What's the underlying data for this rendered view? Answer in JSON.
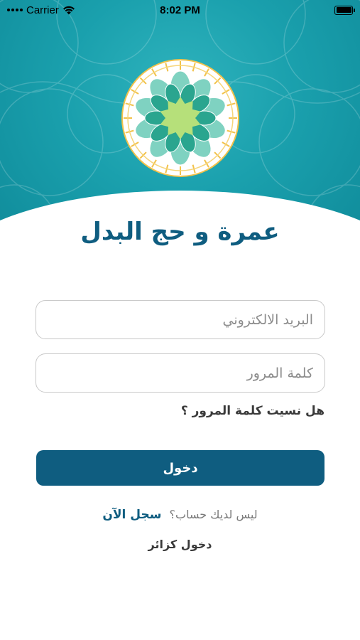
{
  "status_bar": {
    "carrier": "Carrier",
    "time": "8:02 PM",
    "icons": [
      "signal-dots-icon",
      "wifi-icon",
      "battery-icon"
    ]
  },
  "app": {
    "title": "عمرة و حج البدل",
    "logo_icon": "islamic-rosette-logo"
  },
  "form": {
    "email_placeholder": "البريد الالكتروني",
    "email_value": "",
    "password_placeholder": "كلمة المرور",
    "password_value": "",
    "forgot_password": "هل نسيت كلمة المرور ؟",
    "login_label": "دخول"
  },
  "signup": {
    "question": "ليس لديك حساب؟",
    "link": "سجل الآن"
  },
  "guest_login": "دخول كزائر",
  "colors": {
    "primary": "#0f5d80",
    "hero": "#1aa0ad",
    "logo_green": "#b6e07a",
    "logo_teal": "#2aa58f",
    "logo_gold": "#f2c24a"
  }
}
